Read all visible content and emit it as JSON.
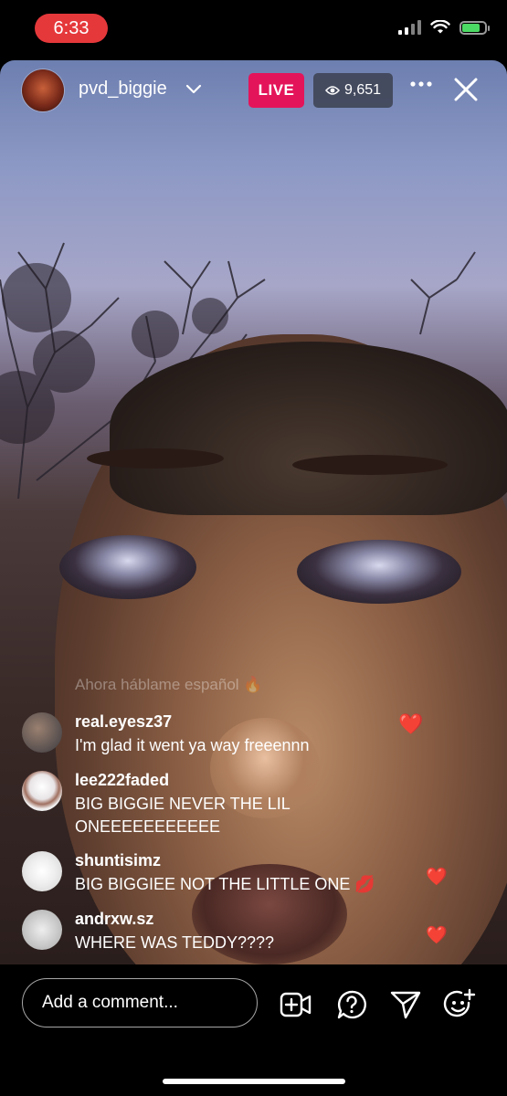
{
  "status_bar": {
    "time": "6:33"
  },
  "stream": {
    "username": "pvd_biggie",
    "live_label": "LIVE",
    "viewer_count": "9,651",
    "faded_comment": "Ahora háblame español 🔥"
  },
  "comments": [
    {
      "user": "real.eyesz37",
      "text": "I'm glad it went ya way freeennn",
      "heart": "❤️"
    },
    {
      "user": "lee222faded",
      "text": "BIG BIGGIE NEVER THE LIL ONEEEEEEEEEEE",
      "heart": ""
    },
    {
      "user": "shuntisimz",
      "text": "BIG BIGGIEE NOT THE LITTLE ONE 💋",
      "heart": "❤️"
    },
    {
      "user": "andrxw.sz",
      "text": "WHERE WAS TEDDY????",
      "heart": "❤️"
    }
  ],
  "comment_input": {
    "placeholder": "Add a comment..."
  },
  "icons": {
    "dropdown": "chevron-down-icon",
    "views": "eye-icon",
    "more": "more-icon",
    "close": "close-icon",
    "add_video": "add-video-icon",
    "question": "question-icon",
    "share": "send-icon",
    "emoji": "add-emoji-icon"
  },
  "colors": {
    "live_badge": "#e4145a",
    "time_pill": "#e5383b",
    "heart": "#ed1c24",
    "battery": "#4cd964"
  }
}
